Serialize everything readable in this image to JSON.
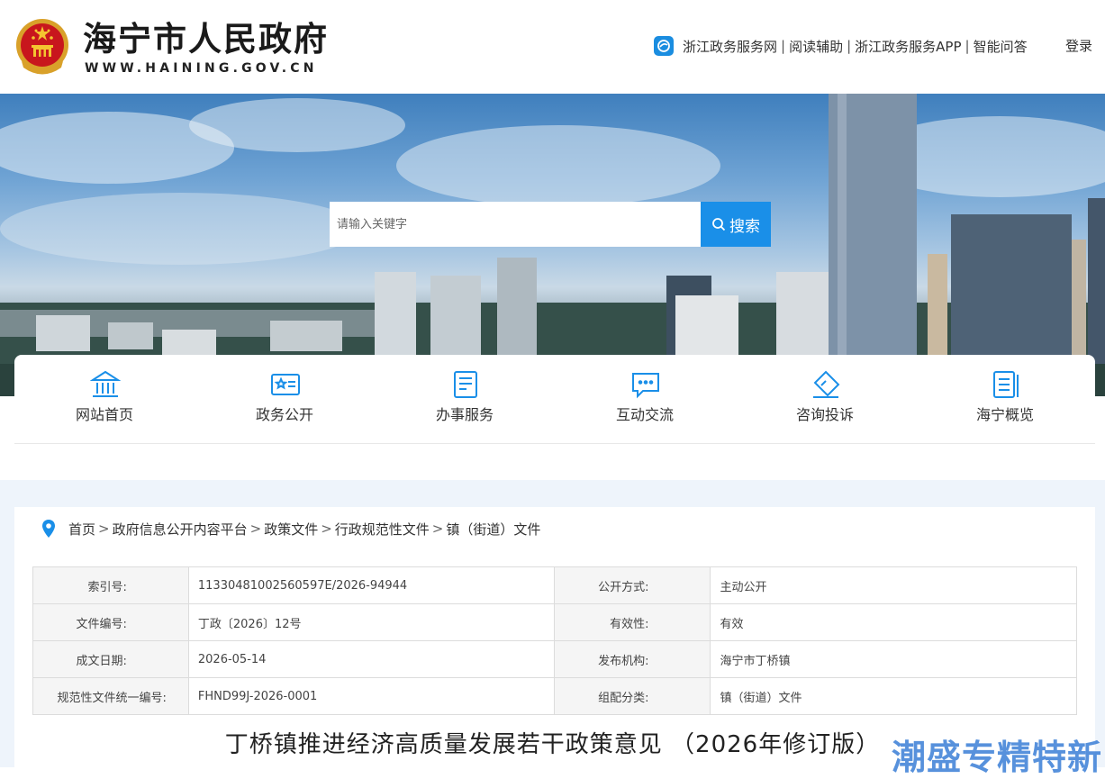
{
  "header": {
    "site_name": "海宁市人民政府",
    "site_url": "WWW.HAINING.GOV.CN",
    "links": [
      "浙江政务服务网",
      "阅读辅助",
      "浙江政务服务APP",
      "智能问答"
    ],
    "separator": "|",
    "login": "登录"
  },
  "search": {
    "placeholder": "请输入关键字",
    "button": "搜索"
  },
  "nav": [
    {
      "label": "网站首页",
      "icon": "bank-icon"
    },
    {
      "label": "政务公开",
      "icon": "id-card-icon"
    },
    {
      "label": "办事服务",
      "icon": "document-icon"
    },
    {
      "label": "互动交流",
      "icon": "chat-bubble-icon"
    },
    {
      "label": "咨询投诉",
      "icon": "pen-tag-icon"
    },
    {
      "label": "海宁概览",
      "icon": "book-icon"
    }
  ],
  "breadcrumb": [
    "首页",
    "政府信息公开内容平台",
    "政策文件",
    "行政规范性文件",
    "镇（街道）文件"
  ],
  "meta": {
    "rows": [
      {
        "k1": "索引号:",
        "v1": "11330481002560597E/2026-94944",
        "k2": "公开方式:",
        "v2": "主动公开"
      },
      {
        "k1": "文件编号:",
        "v1": "丁政〔2026〕12号",
        "k2": "有效性:",
        "v2": "有效"
      },
      {
        "k1": "成文日期:",
        "v1": "2026-05-14",
        "k2": "发布机构:",
        "v2": "海宁市丁桥镇"
      },
      {
        "k1": "规范性文件统一编号:",
        "v1": "FHND99J-2026-0001",
        "k2": "组配分类:",
        "v2": "镇（街道）文件"
      }
    ]
  },
  "doc_title": "丁桥镇推进经济高质量发展若干政策意见 （2026年修订版）",
  "watermark": "潮盛专精特新",
  "colors": {
    "accent": "#1a8fe8",
    "page_bg": "#eef4fb",
    "icon": "#1a8fe8"
  }
}
